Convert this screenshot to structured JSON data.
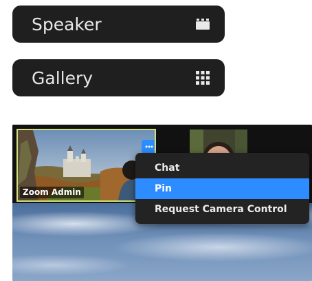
{
  "view_buttons": {
    "speaker": {
      "label": "Speaker",
      "icon": "speaker-view-icon"
    },
    "gallery": {
      "label": "Gallery",
      "icon": "gallery-grid-icon"
    }
  },
  "meeting": {
    "participants": [
      {
        "name": "Zoom Admin",
        "highlighted": true
      },
      {
        "name": ""
      }
    ],
    "more_icon": "ellipsis-icon"
  },
  "context_menu": {
    "items": [
      {
        "label": "Chat",
        "selected": false
      },
      {
        "label": "Pin",
        "selected": true
      },
      {
        "label": "Request Camera Control",
        "selected": false
      }
    ]
  },
  "colors": {
    "button_bg": "#1f1f1f",
    "accent": "#2d8cff",
    "tile_highlight": "#cfe07a",
    "menu_bg": "#232323"
  }
}
